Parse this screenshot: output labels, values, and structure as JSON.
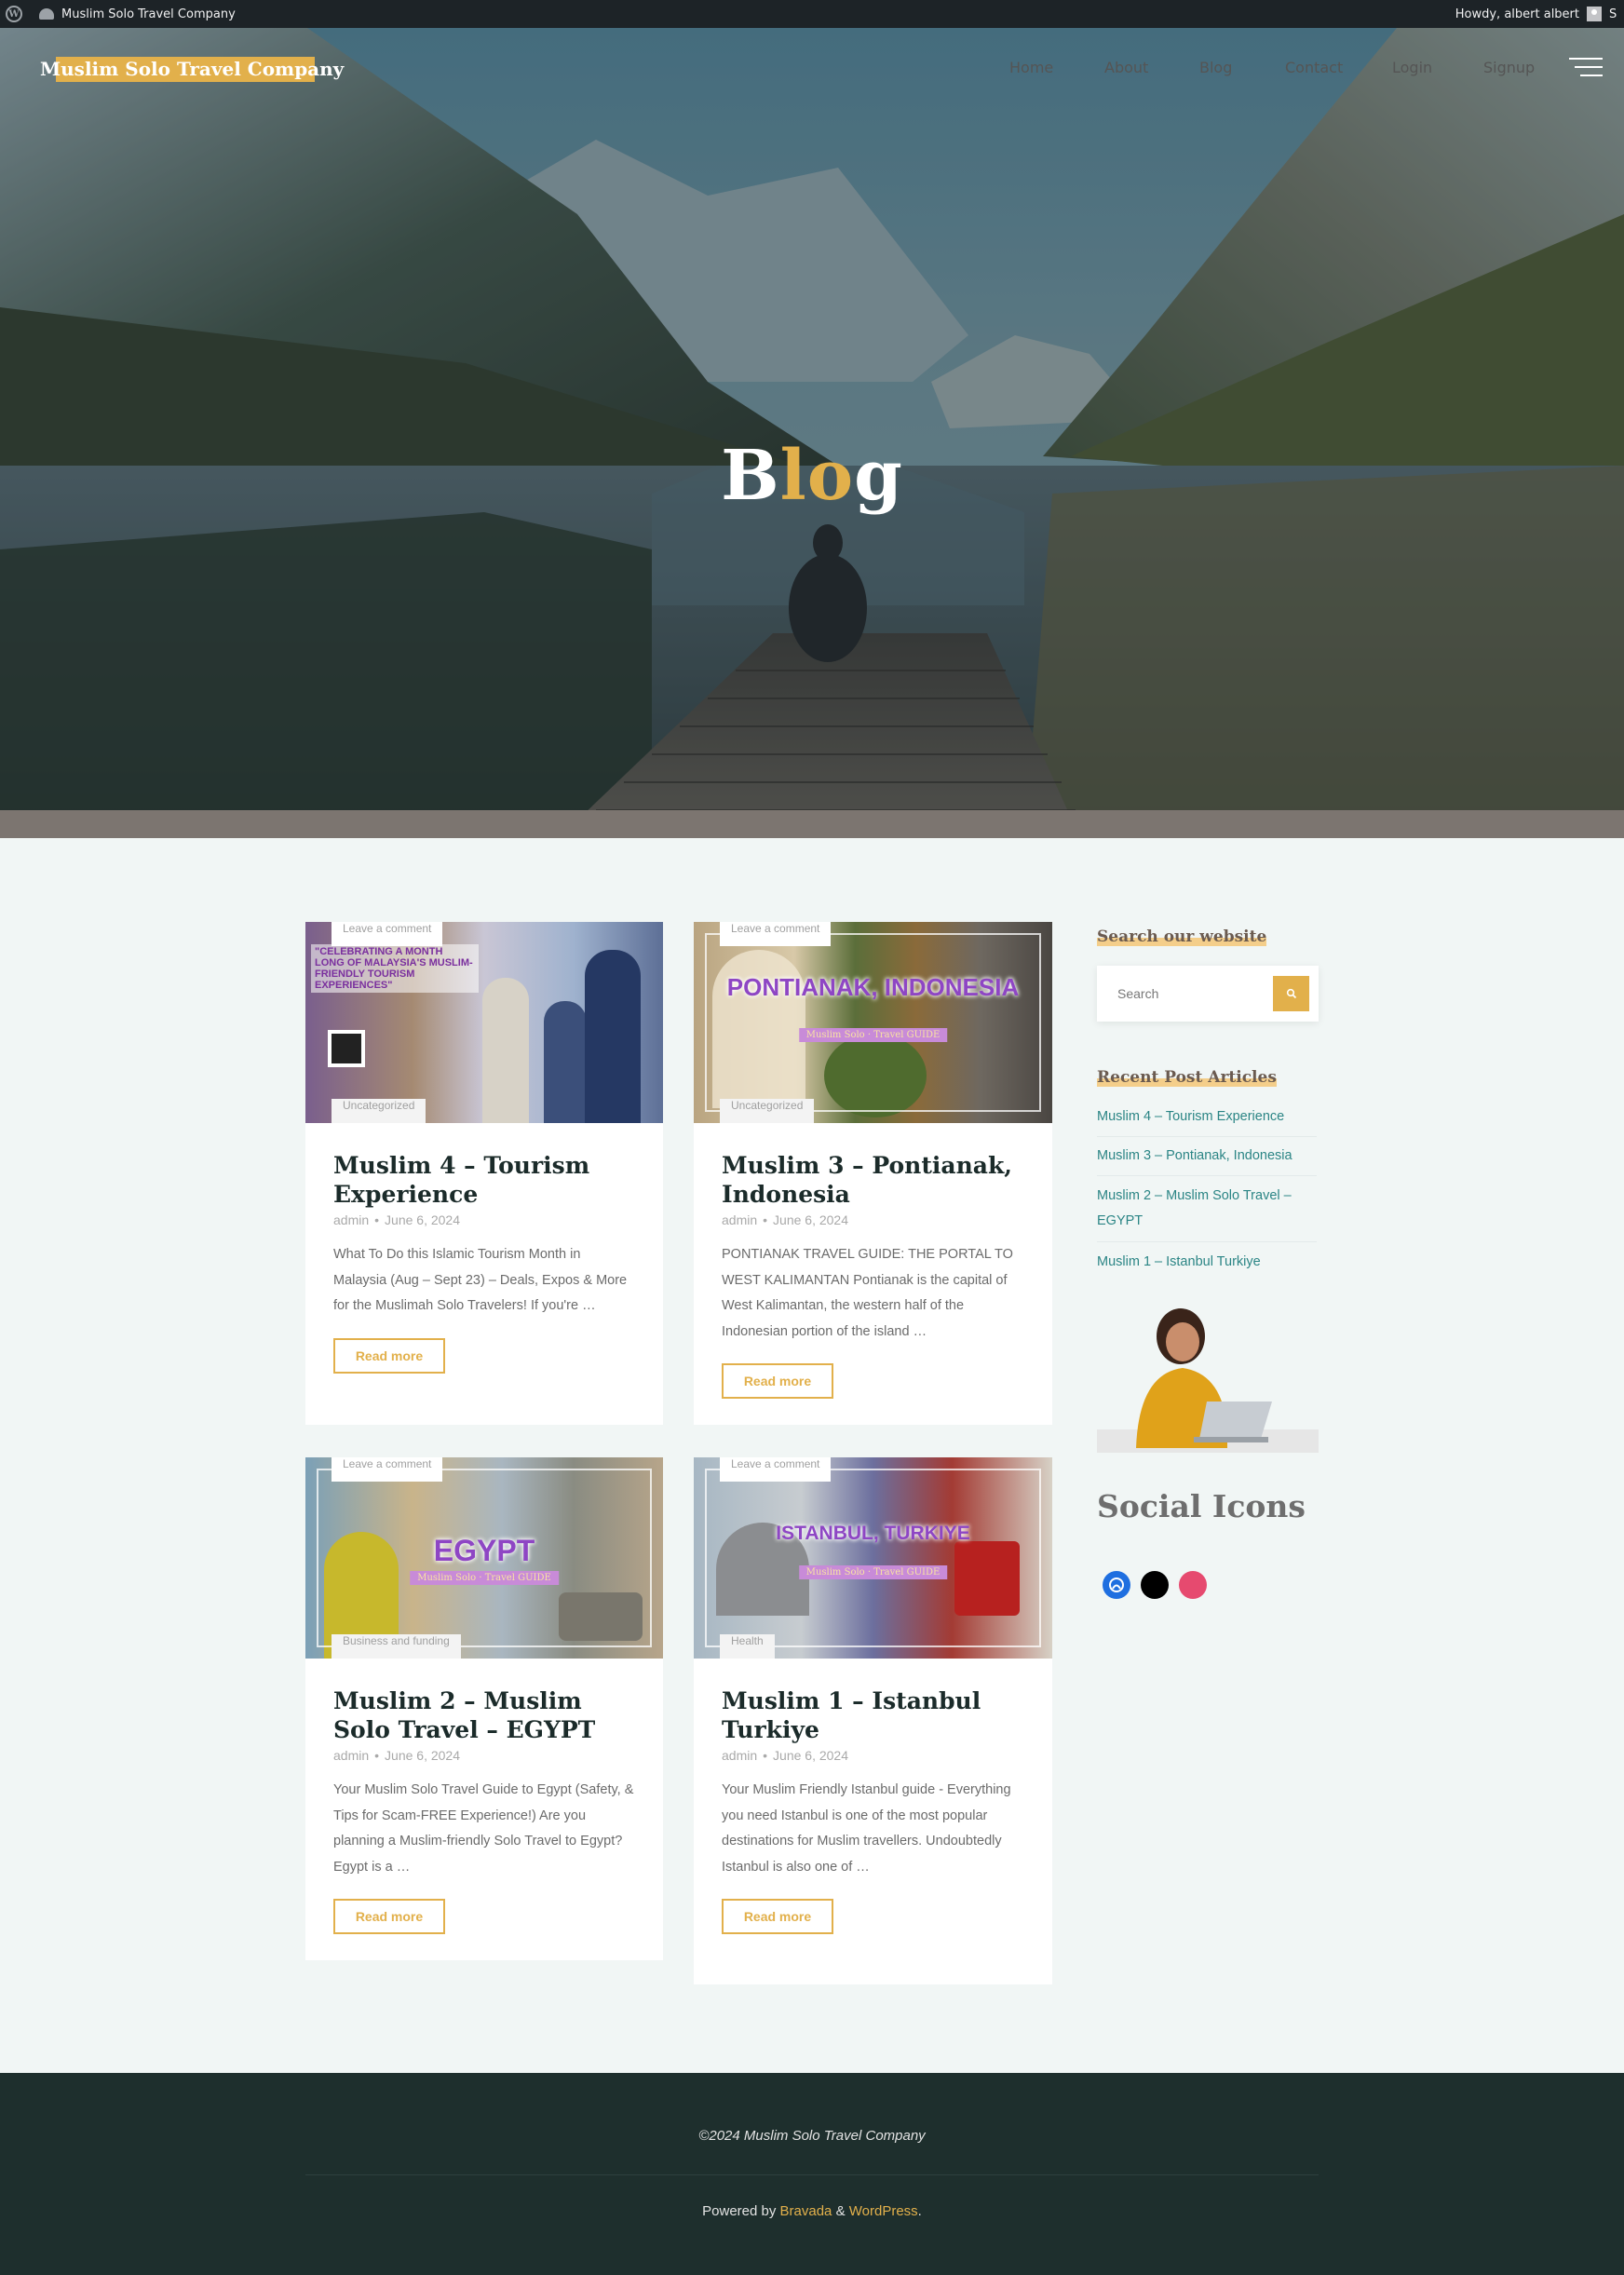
{
  "admin_bar": {
    "site_name": "Muslim Solo Travel Company",
    "greeting": "Howdy, albert albert",
    "cut_text": "S"
  },
  "header": {
    "logo": "Muslim Solo Travel Company",
    "nav": [
      "Home",
      "About",
      "Blog",
      "Contact",
      "Login",
      "Signup"
    ],
    "active": "Blog"
  },
  "hero": {
    "title_b": "B",
    "title_lo": "lo",
    "title_g": "g"
  },
  "posts": [
    {
      "comment": "Leave a comment",
      "category": "Uncategorized",
      "title": "Muslim 4 – Tourism Experience",
      "author": "admin",
      "date": "June 6, 2024",
      "excerpt": "What To Do this Islamic Tourism Month in Malaysia (Aug – Sept 23) – Deals, Expos & More for the Muslimah Solo Travelers! If you're …",
      "read_more": "Read more",
      "image_text": "\"CELEBRATING A MONTH LONG OF MALAYSIA'S MUSLIM-FRIENDLY TOURISM EXPERIENCES\""
    },
    {
      "comment": "Leave a comment",
      "category": "Uncategorized",
      "title": "Muslim 3 – Pontianak, Indonesia",
      "author": "admin",
      "date": "June 6, 2024",
      "excerpt": "PONTIANAK TRAVEL GUIDE: THE PORTAL TO WEST KALIMANTAN Pontianak is the capital of West Kalimantan, the western half of the Indonesian portion of the island …",
      "read_more": "Read more",
      "image_text": "PONTIANAK, INDONESIA",
      "image_sub": "Muslim Solo · Travel GUIDE"
    },
    {
      "comment": "Leave a comment",
      "category": "Business and funding",
      "title": "Muslim 2 – Muslim Solo Travel – EGYPT",
      "author": "admin",
      "date": "June 6, 2024",
      "excerpt": "Your Muslim Solo Travel Guide to Egypt (Safety, & Tips for Scam-FREE Experience!) Are you planning a Muslim-friendly Solo Travel to Egypt? Egypt is a …",
      "read_more": "Read more",
      "image_text": "EGYPT",
      "image_sub": "Muslim Solo · Travel GUIDE"
    },
    {
      "comment": "Leave a comment",
      "category": "Health",
      "title": "Muslim 1 – Istanbul Turkiye",
      "author": "admin",
      "date": "June 6, 2024",
      "excerpt": "Your Muslim Friendly Istanbul guide - Everything you need Istanbul is one of the most popular destinations for Muslim travellers. Undoubtedly Istanbul is also one of …",
      "read_more": "Read more",
      "image_text": "ISTANBUL, TURKIYE",
      "image_sub": "Muslim Solo · Travel GUIDE"
    }
  ],
  "sidebar": {
    "search_title": "Search our website",
    "search_placeholder": "Search",
    "recent_title": "Recent Post Articles",
    "recent": [
      "Muslim 4 – Tourism Experience",
      "Muslim 3 – Pontianak, Indonesia",
      "Muslim 2 – Muslim Solo Travel – EGYPT",
      "Muslim 1 – Istanbul Turkiye"
    ],
    "social_title": "Social Icons",
    "social_icons": [
      "xbox-icon",
      "x-icon",
      "dribbble-icon"
    ]
  },
  "footer": {
    "copyright": "©2024 Muslim Solo Travel Company",
    "powered_prefix": "Powered by ",
    "theme": "Bravada",
    "amp": " & ",
    "cms": "WordPress",
    "suffix": "."
  },
  "colors": {
    "accent": "#e2b04b",
    "link": "#2b8585",
    "footer": "#1e2f2d",
    "admin_bar": "#1d2327"
  }
}
